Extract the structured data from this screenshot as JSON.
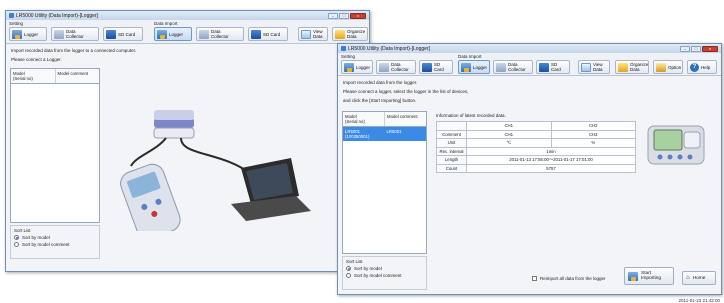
{
  "window1": {
    "title": "LR5000 Utility (Data Import)-[Logger]",
    "setting_label": "Setting",
    "data_import_label": "Data Import",
    "buttons": {
      "logger": "Logger",
      "data_collector": "Data\nCollector",
      "sd_card": "SD Card",
      "di_logger": "Logger",
      "di_data_collector": "Data\nCollector",
      "di_sd_card": "SD Card",
      "view_data": "View\nData",
      "organize_data": "Organize\nData",
      "option": "Option",
      "help": "Help"
    },
    "message_line1": "Import recorded data from the logger to a connected computer.",
    "message_line2": "Please connect a Logger.",
    "model_table": {
      "col1": "Model\n(Serial no)",
      "col2": "Model comment"
    },
    "sort_list": {
      "label": "Sort List",
      "opt1": "Sort by model",
      "opt2": "Sort by model comment"
    }
  },
  "window2": {
    "title": "LR5000 Utility (Data Import)-[Logger]",
    "setting_label": "Setting",
    "data_import_label": "Data Import",
    "buttons": {
      "logger": "Logger",
      "data_collector": "Data\nCollector",
      "sd_card": "SD Card",
      "di_logger": "Logger",
      "di_data_collector": "Data\nCollector",
      "di_sd_card": "SD Card",
      "view_data": "View\nData",
      "organize_data": "Organize\nData",
      "option": "Option",
      "help": "Help"
    },
    "message_line1": "Import recorded data from the logger.",
    "message_line2": "Please connect a logger, select the logger in the list of devices,",
    "message_line3": "and click the [Start Importing] button.",
    "model_table": {
      "col1": "Model\n(Serial no)",
      "col2": "Model comment",
      "row_model": "LR5001\n(100350001)",
      "row_comment": "LR5001"
    },
    "info_title": "Information of latest recorded data.",
    "info": {
      "ch1": "CH1",
      "ch2": "CH2",
      "comment_label": "Comment",
      "comment_ch1": "CH1",
      "comment_ch2": "CH2",
      "unit_label": "Unit",
      "unit_ch1": "℃",
      "unit_ch2": "%",
      "rec_interval_label": "Rec. interval",
      "rec_interval_value": "1min",
      "length_label": "Length",
      "length_value": "2011-01-13 17:56:00～2011-01-17 17:01:00",
      "count_label": "Count",
      "count_value": "5757"
    },
    "sort_list": {
      "label": "Sort List",
      "opt1": "Sort by model",
      "opt2": "Sort by model comment"
    },
    "reimport_label": "Reimport all data from the logger",
    "start_importing": "Start Importing",
    "home": "Home",
    "timestamp": "2011-01-23 21:42:00"
  }
}
